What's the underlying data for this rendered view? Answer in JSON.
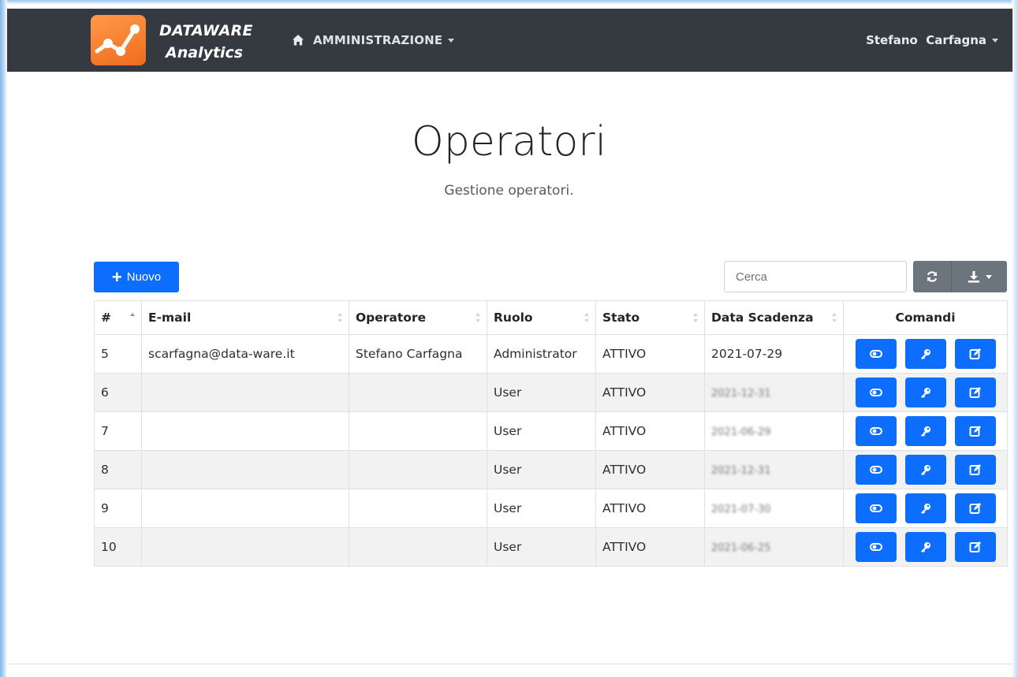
{
  "header": {
    "brand_line1": "DATAWARE",
    "brand_line2": "Analytics",
    "menu_label": "AMMINISTRAZIONE",
    "user_name": "Stefano  Carfagna"
  },
  "page": {
    "title": "Operatori",
    "subtitle": "Gestione operatori."
  },
  "toolbar": {
    "new_label": "Nuovo",
    "search_placeholder": "Cerca"
  },
  "table": {
    "columns": [
      "#",
      "E-mail",
      "Operatore",
      "Ruolo",
      "Stato",
      "Data Scadenza",
      "Comandi"
    ],
    "rows": [
      {
        "id": "5",
        "email": "scarfagna@data-ware.it",
        "operator": "Stefano Carfagna",
        "role": "Administrator",
        "status": "ATTIVO",
        "expiry": "2021-07-29"
      },
      {
        "id": "6",
        "email": "",
        "operator": "",
        "role": "User",
        "status": "ATTIVO",
        "expiry": "2021-12-31"
      },
      {
        "id": "7",
        "email": "",
        "operator": "",
        "role": "User",
        "status": "ATTIVO",
        "expiry": "2021-06-29"
      },
      {
        "id": "8",
        "email": "",
        "operator": "",
        "role": "User",
        "status": "ATTIVO",
        "expiry": "2021-12-31"
      },
      {
        "id": "9",
        "email": "",
        "operator": "",
        "role": "User",
        "status": "ATTIVO",
        "expiry": "2021-07-30"
      },
      {
        "id": "10",
        "email": "",
        "operator": "",
        "role": "User",
        "status": "ATTIVO",
        "expiry": "2021-06-25"
      }
    ]
  },
  "colors": {
    "navbar": "#343a40",
    "primary": "#0d6efd",
    "secondary": "#6c757d",
    "logo": "#f06b1d"
  },
  "icons": {
    "home": "home-icon",
    "refresh": "refresh-icon",
    "export": "download-icon",
    "row_commands": [
      "toggle-icon",
      "key-icon",
      "edit-icon"
    ]
  }
}
